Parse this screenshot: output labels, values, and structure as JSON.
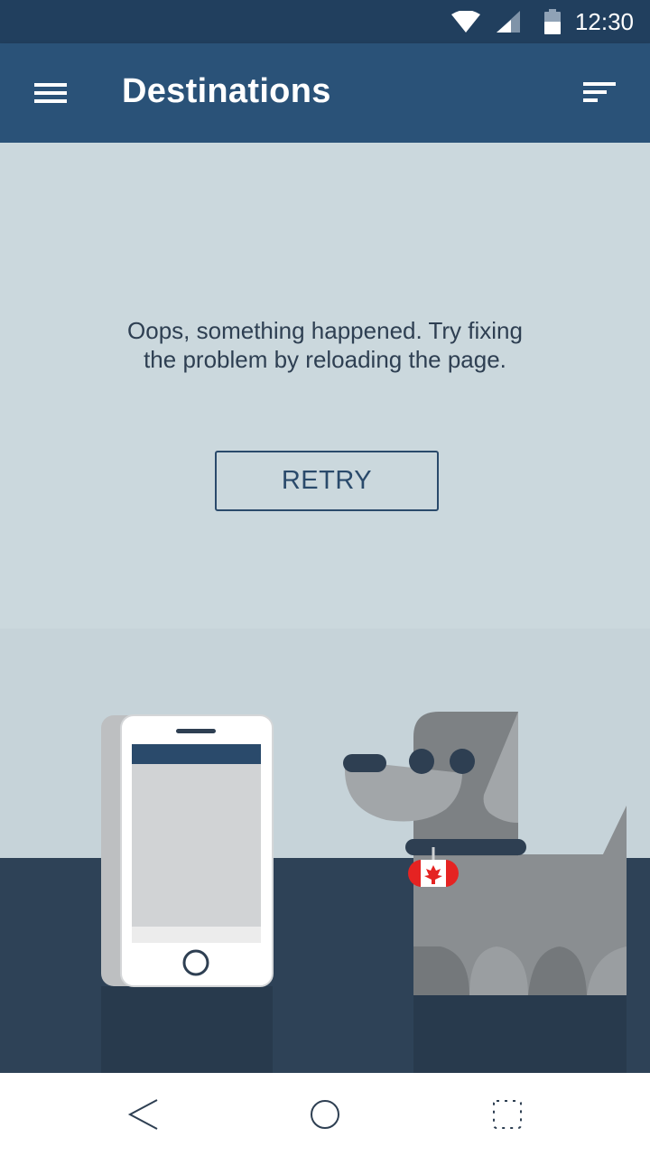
{
  "status_bar": {
    "time": "12:30",
    "icons": [
      "wifi-icon",
      "cellular-signal-icon",
      "battery-icon"
    ]
  },
  "app_bar": {
    "title": "Destinations",
    "icons": [
      "menu-icon",
      "sort-icon"
    ]
  },
  "error": {
    "message": "Oops, something happened. Try fixing the problem by reloading the page.",
    "retry_label": "RETRY"
  },
  "navigation": {
    "icons": [
      "back-icon",
      "home-icon",
      "recents-icon"
    ]
  },
  "colors": {
    "status_bar": "#213f5e",
    "app_bar": "#2a5278",
    "background": "#cbd8dd",
    "floor": "#2e4257",
    "accent_text": "#2a4a6b"
  }
}
